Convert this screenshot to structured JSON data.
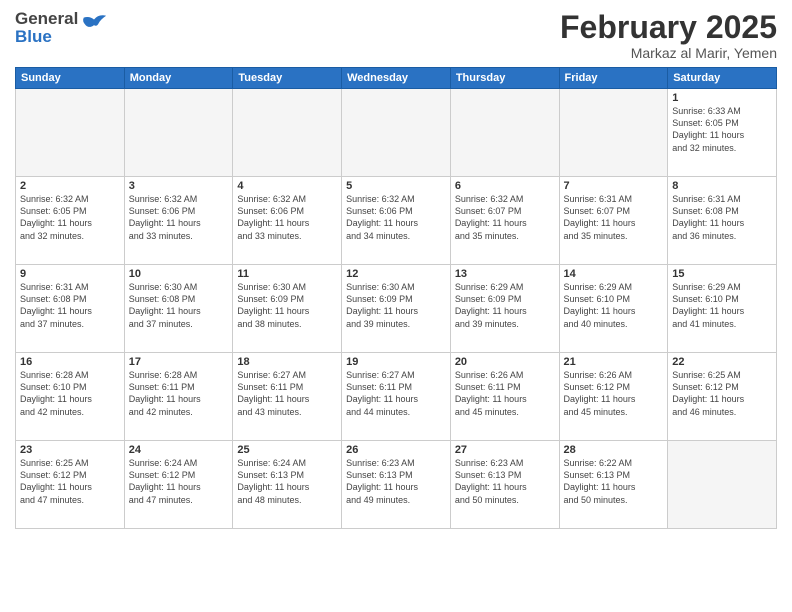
{
  "logo": {
    "line1": "General",
    "line2": "Blue"
  },
  "title": "February 2025",
  "subtitle": "Markaz al Marir, Yemen",
  "days_header": [
    "Sunday",
    "Monday",
    "Tuesday",
    "Wednesday",
    "Thursday",
    "Friday",
    "Saturday"
  ],
  "weeks": [
    [
      {
        "num": "",
        "info": "",
        "empty": true
      },
      {
        "num": "",
        "info": "",
        "empty": true
      },
      {
        "num": "",
        "info": "",
        "empty": true
      },
      {
        "num": "",
        "info": "",
        "empty": true
      },
      {
        "num": "",
        "info": "",
        "empty": true
      },
      {
        "num": "",
        "info": "",
        "empty": true
      },
      {
        "num": "1",
        "info": "Sunrise: 6:33 AM\nSunset: 6:05 PM\nDaylight: 11 hours\nand 32 minutes."
      }
    ],
    [
      {
        "num": "2",
        "info": "Sunrise: 6:32 AM\nSunset: 6:05 PM\nDaylight: 11 hours\nand 32 minutes."
      },
      {
        "num": "3",
        "info": "Sunrise: 6:32 AM\nSunset: 6:06 PM\nDaylight: 11 hours\nand 33 minutes."
      },
      {
        "num": "4",
        "info": "Sunrise: 6:32 AM\nSunset: 6:06 PM\nDaylight: 11 hours\nand 33 minutes."
      },
      {
        "num": "5",
        "info": "Sunrise: 6:32 AM\nSunset: 6:06 PM\nDaylight: 11 hours\nand 34 minutes."
      },
      {
        "num": "6",
        "info": "Sunrise: 6:32 AM\nSunset: 6:07 PM\nDaylight: 11 hours\nand 35 minutes."
      },
      {
        "num": "7",
        "info": "Sunrise: 6:31 AM\nSunset: 6:07 PM\nDaylight: 11 hours\nand 35 minutes."
      },
      {
        "num": "8",
        "info": "Sunrise: 6:31 AM\nSunset: 6:08 PM\nDaylight: 11 hours\nand 36 minutes."
      }
    ],
    [
      {
        "num": "9",
        "info": "Sunrise: 6:31 AM\nSunset: 6:08 PM\nDaylight: 11 hours\nand 37 minutes."
      },
      {
        "num": "10",
        "info": "Sunrise: 6:30 AM\nSunset: 6:08 PM\nDaylight: 11 hours\nand 37 minutes."
      },
      {
        "num": "11",
        "info": "Sunrise: 6:30 AM\nSunset: 6:09 PM\nDaylight: 11 hours\nand 38 minutes."
      },
      {
        "num": "12",
        "info": "Sunrise: 6:30 AM\nSunset: 6:09 PM\nDaylight: 11 hours\nand 39 minutes."
      },
      {
        "num": "13",
        "info": "Sunrise: 6:29 AM\nSunset: 6:09 PM\nDaylight: 11 hours\nand 39 minutes."
      },
      {
        "num": "14",
        "info": "Sunrise: 6:29 AM\nSunset: 6:10 PM\nDaylight: 11 hours\nand 40 minutes."
      },
      {
        "num": "15",
        "info": "Sunrise: 6:29 AM\nSunset: 6:10 PM\nDaylight: 11 hours\nand 41 minutes."
      }
    ],
    [
      {
        "num": "16",
        "info": "Sunrise: 6:28 AM\nSunset: 6:10 PM\nDaylight: 11 hours\nand 42 minutes."
      },
      {
        "num": "17",
        "info": "Sunrise: 6:28 AM\nSunset: 6:11 PM\nDaylight: 11 hours\nand 42 minutes."
      },
      {
        "num": "18",
        "info": "Sunrise: 6:27 AM\nSunset: 6:11 PM\nDaylight: 11 hours\nand 43 minutes."
      },
      {
        "num": "19",
        "info": "Sunrise: 6:27 AM\nSunset: 6:11 PM\nDaylight: 11 hours\nand 44 minutes."
      },
      {
        "num": "20",
        "info": "Sunrise: 6:26 AM\nSunset: 6:11 PM\nDaylight: 11 hours\nand 45 minutes."
      },
      {
        "num": "21",
        "info": "Sunrise: 6:26 AM\nSunset: 6:12 PM\nDaylight: 11 hours\nand 45 minutes."
      },
      {
        "num": "22",
        "info": "Sunrise: 6:25 AM\nSunset: 6:12 PM\nDaylight: 11 hours\nand 46 minutes."
      }
    ],
    [
      {
        "num": "23",
        "info": "Sunrise: 6:25 AM\nSunset: 6:12 PM\nDaylight: 11 hours\nand 47 minutes."
      },
      {
        "num": "24",
        "info": "Sunrise: 6:24 AM\nSunset: 6:12 PM\nDaylight: 11 hours\nand 47 minutes."
      },
      {
        "num": "25",
        "info": "Sunrise: 6:24 AM\nSunset: 6:13 PM\nDaylight: 11 hours\nand 48 minutes."
      },
      {
        "num": "26",
        "info": "Sunrise: 6:23 AM\nSunset: 6:13 PM\nDaylight: 11 hours\nand 49 minutes."
      },
      {
        "num": "27",
        "info": "Sunrise: 6:23 AM\nSunset: 6:13 PM\nDaylight: 11 hours\nand 50 minutes."
      },
      {
        "num": "28",
        "info": "Sunrise: 6:22 AM\nSunset: 6:13 PM\nDaylight: 11 hours\nand 50 minutes."
      },
      {
        "num": "",
        "info": "",
        "empty": true
      }
    ]
  ]
}
